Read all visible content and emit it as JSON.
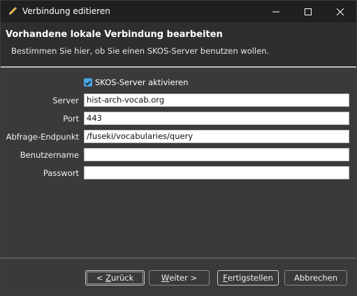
{
  "window": {
    "title": "Verbindung editieren",
    "controls": {
      "minimize": "minimize-icon",
      "maximize": "maximize-icon",
      "close": "close-icon"
    }
  },
  "header": {
    "title": "Vorhandene lokale Verbindung bearbeiten",
    "description": "Bestimmen Sie hier, ob Sie einen SKOS-Server benutzen wollen."
  },
  "form": {
    "enable_skos": {
      "label": "SKOS-Server aktivieren",
      "checked": true
    },
    "server": {
      "label": "Server",
      "value": "hist-arch-vocab.org"
    },
    "port": {
      "label": "Port",
      "value": "443"
    },
    "query_endpoint": {
      "label": "Abfrage-Endpunkt",
      "value": "/fuseki/vocabularies/query"
    },
    "username": {
      "label": "Benutzername",
      "value": ""
    },
    "password": {
      "label": "Passwort",
      "value": ""
    }
  },
  "buttons": {
    "back": {
      "prefix": "< ",
      "mnemonic": "Z",
      "rest": "urück"
    },
    "next": {
      "mnemonic": "W",
      "rest": "eiter >"
    },
    "finish": {
      "mnemonic": "F",
      "rest": "ertigstellen"
    },
    "cancel": {
      "label": "Abbrechen"
    }
  },
  "colors": {
    "accent": "#4aa3df",
    "titlebar": "#202020",
    "background": "#3a3a3a"
  }
}
